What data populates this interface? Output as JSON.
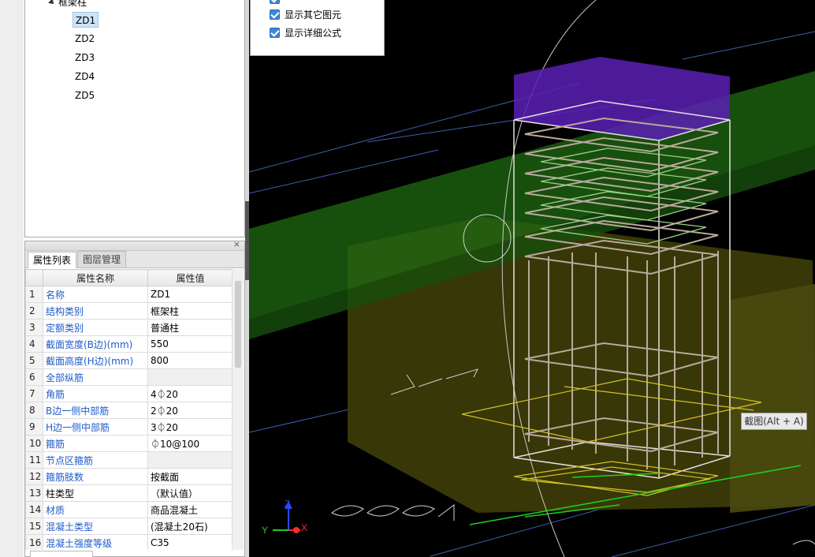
{
  "tree": {
    "root_label": "框架柱",
    "items": [
      {
        "label": "ZD1",
        "selected": true
      },
      {
        "label": "ZD2",
        "selected": false
      },
      {
        "label": "ZD3",
        "selected": false
      },
      {
        "label": "ZD4",
        "selected": false
      },
      {
        "label": "ZD5",
        "selected": false
      }
    ]
  },
  "props_panel": {
    "close_label": "×",
    "tabs": [
      {
        "label": "属性列表",
        "active": true
      },
      {
        "label": "图层管理",
        "active": false
      }
    ],
    "columns": [
      "属性名称",
      "属性值"
    ],
    "rows": [
      {
        "num": "1",
        "name": "名称",
        "value": "ZD1",
        "name_color": "blue"
      },
      {
        "num": "2",
        "name": "结构类别",
        "value": "框架柱",
        "name_color": "blue"
      },
      {
        "num": "3",
        "name": "定额类别",
        "value": "普通柱",
        "name_color": "blue"
      },
      {
        "num": "4",
        "name": "截面宽度(B边)(mm)",
        "value": "550",
        "name_color": "blue"
      },
      {
        "num": "5",
        "name": "截面高度(H边)(mm)",
        "value": "800",
        "name_color": "blue"
      },
      {
        "num": "6",
        "name": "全部纵筋",
        "value": "",
        "name_color": "blue"
      },
      {
        "num": "7",
        "name": "角筋",
        "value": "4⏀20",
        "name_color": "blue"
      },
      {
        "num": "8",
        "name": "B边一侧中部筋",
        "value": "2⏀20",
        "name_color": "blue"
      },
      {
        "num": "9",
        "name": "H边一侧中部筋",
        "value": "3⏀20",
        "name_color": "blue"
      },
      {
        "num": "10",
        "name": "箍筋",
        "value": "⏀10@100",
        "name_color": "blue"
      },
      {
        "num": "11",
        "name": "节点区箍筋",
        "value": "",
        "name_color": "blue"
      },
      {
        "num": "12",
        "name": "箍筋肢数",
        "value": "按截面",
        "name_color": "blue"
      },
      {
        "num": "13",
        "name": "柱类型",
        "value": "（默认值）",
        "name_color": "black"
      },
      {
        "num": "14",
        "name": "材质",
        "value": "商品混凝土",
        "name_color": "blue"
      },
      {
        "num": "15",
        "name": "混凝土类型",
        "value": "(混凝土20石)",
        "name_color": "blue"
      },
      {
        "num": "16",
        "name": "混凝土强度等级",
        "value": "C35",
        "name_color": "blue"
      }
    ]
  },
  "options": [
    {
      "label": "显示其它图元",
      "checked": true
    },
    {
      "label": "显示详细公式",
      "checked": true
    }
  ],
  "viewport": {
    "axis_labels": {
      "x": "X",
      "y": "Y",
      "z": "Z"
    },
    "screenshot_tip": "截图(Alt + A)"
  },
  "colors": {
    "selection": "#cde3f6",
    "link_blue": "#1f5bc8",
    "checkbox": "#3b87d8",
    "viewport_bg": "#000000"
  }
}
